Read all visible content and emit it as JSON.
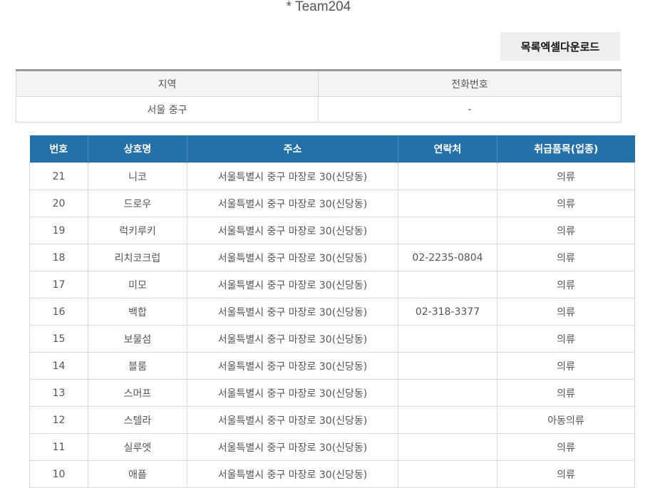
{
  "header": {
    "title": "* Team204"
  },
  "toolbar": {
    "excel_download_label": "목록엑셀다운로드"
  },
  "info_table": {
    "headers": [
      "지역",
      "전화번호"
    ],
    "values": [
      "서울 중구",
      "-"
    ]
  },
  "list_table": {
    "headers": [
      "번호",
      "상호명",
      "주소",
      "연락처",
      "취급품목(업종)"
    ],
    "rows": [
      [
        "21",
        "니코",
        "서울특별시 중구 마장로 30(신당동)",
        "",
        "의류"
      ],
      [
        "20",
        "드로우",
        "서울특별시 중구 마장로 30(신당동)",
        "",
        "의류"
      ],
      [
        "19",
        "럭키루키",
        "서울특별시 중구 마장로 30(신당동)",
        "",
        "의류"
      ],
      [
        "18",
        "리치코크럽",
        "서울특별시 중구 마장로 30(신당동)",
        "02-2235-0804",
        "의류"
      ],
      [
        "17",
        "미모",
        "서울특별시 중구 마장로 30(신당동)",
        "",
        "의류"
      ],
      [
        "16",
        "백합",
        "서울특별시 중구 마장로 30(신당동)",
        "02-318-3377",
        "의류"
      ],
      [
        "15",
        "보물섬",
        "서울특별시 중구 마장로 30(신당동)",
        "",
        "의류"
      ],
      [
        "14",
        "블룸",
        "서울특별시 중구 마장로 30(신당동)",
        "",
        "의류"
      ],
      [
        "13",
        "스머프",
        "서울특별시 중구 마장로 30(신당동)",
        "",
        "의류"
      ],
      [
        "12",
        "스텔라",
        "서울특별시 중구 마장로 30(신당동)",
        "",
        "아동의류"
      ],
      [
        "11",
        "실루엣",
        "서울특별시 중구 마장로 30(신당동)",
        "",
        "의류"
      ],
      [
        "10",
        "애플",
        "서울특별시 중구 마장로 30(신당동)",
        "",
        "의류"
      ]
    ]
  }
}
